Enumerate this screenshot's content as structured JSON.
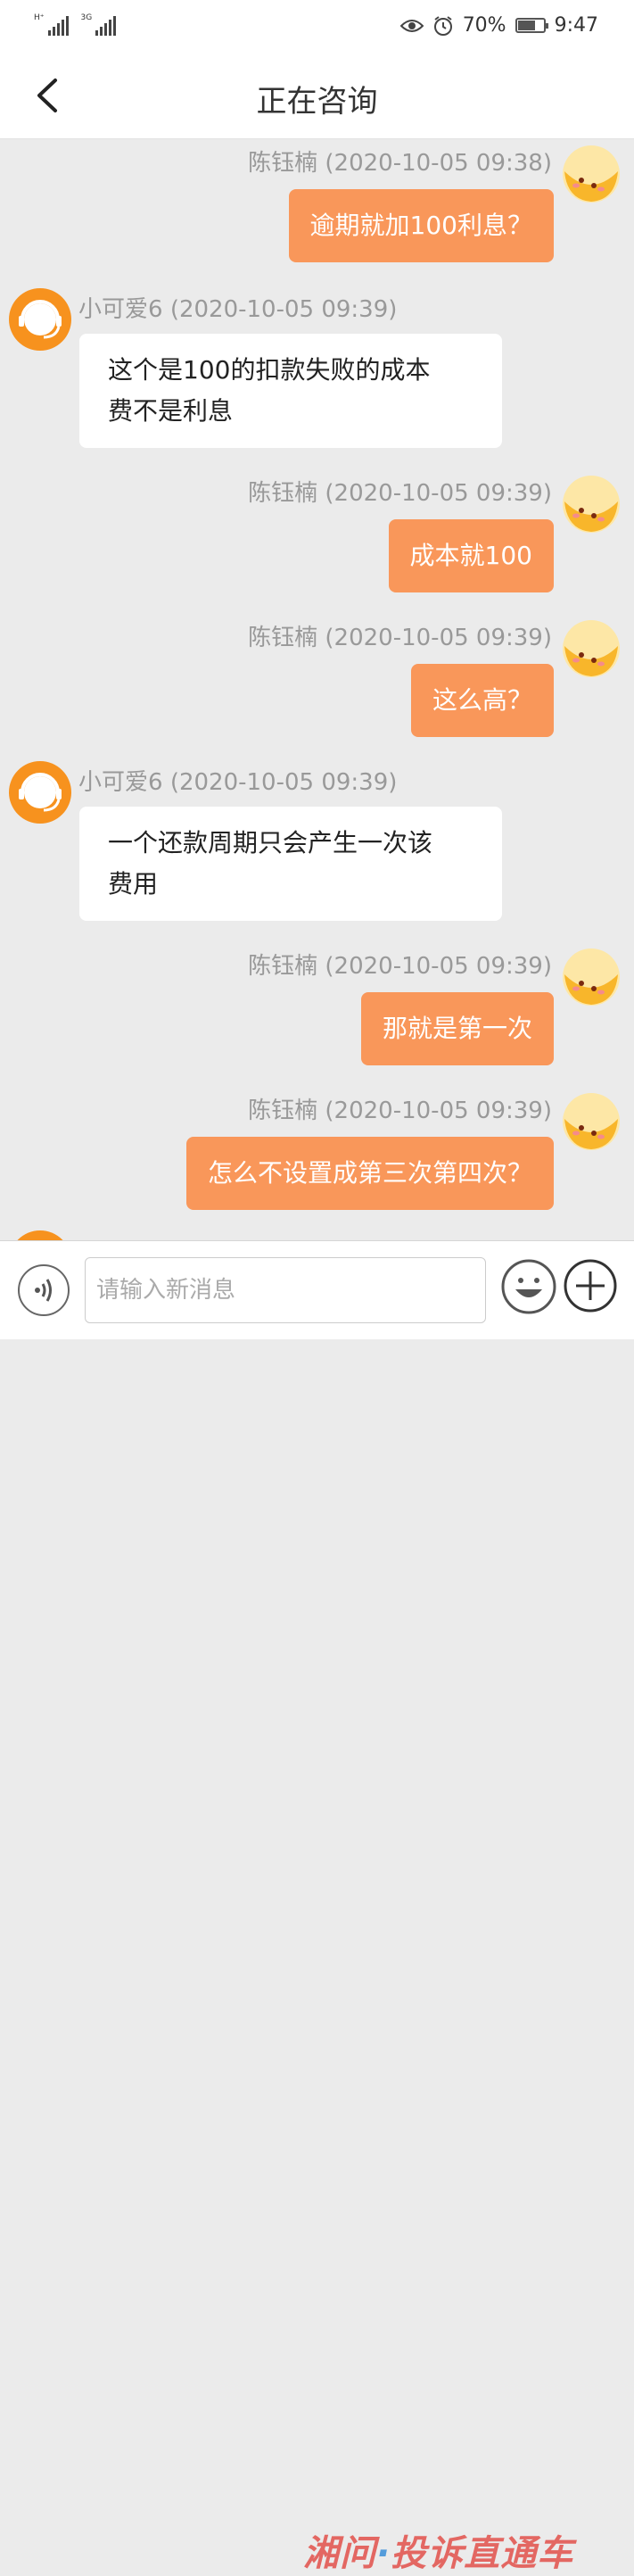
{
  "status_bar": {
    "network1": "H⁺",
    "network2": "3G",
    "battery": "70%",
    "time": "9:47",
    "battery_level": 0.7
  },
  "header": {
    "title": "正在咨询"
  },
  "messages": [
    {
      "sender": "陈钰楠",
      "time": "(2020-10-05 09:38)",
      "text": "逾期就加100利息？"
    },
    {
      "sender": "小可爱6",
      "time": "(2020-10-05 09:39)",
      "line1": "这个是100的扣款失败的成本",
      "line2": "费不是利息"
    },
    {
      "sender": "陈钰楠",
      "time": "(2020-10-05 09:39)",
      "text": "成本就100"
    },
    {
      "sender": "陈钰楠",
      "time": "(2020-10-05 09:39)",
      "text": "这么高？"
    },
    {
      "sender": "小可爱6",
      "time": "(2020-10-05 09:39)",
      "line1": "一个还款周期只会产生一次该",
      "line2": "费用"
    },
    {
      "sender": "陈钰楠",
      "time": "(2020-10-05 09:39)",
      "text": "那就是第一次"
    },
    {
      "sender": "陈钰楠",
      "time": "(2020-10-05 09:39)",
      "text": "怎么不设置成第三次第四次？"
    }
  ],
  "input_bar": {
    "placeholder": "请输入新消息"
  },
  "watermark": {
    "part1": "湘问",
    "part2": "·",
    "part3": "投诉直通车"
  },
  "colors": {
    "user_bubble": "#f9975a",
    "agent_avatar": "#f7921e",
    "background": "#ebebeb"
  },
  "icons": [
    "back-icon",
    "voice-icon",
    "emoji-icon",
    "plus-icon",
    "user-avatar",
    "agent-avatar"
  ]
}
